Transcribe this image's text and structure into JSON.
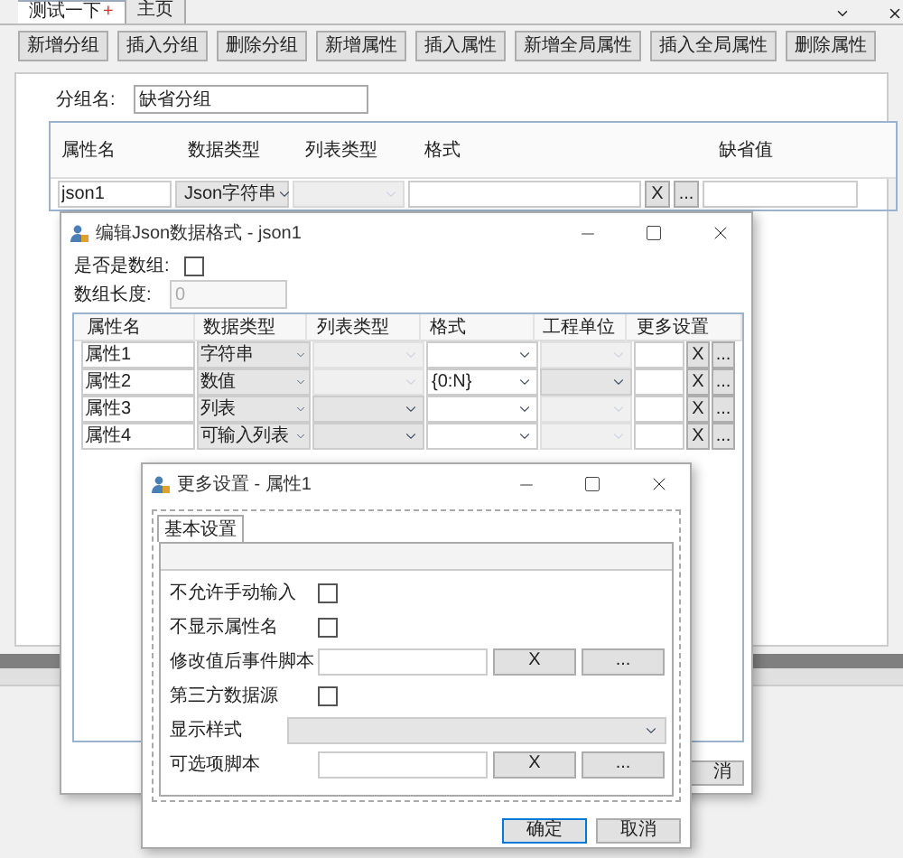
{
  "tabs": [
    {
      "label": "测试一下",
      "selected": true,
      "mark": "+"
    },
    {
      "label": "主页",
      "selected": false
    }
  ],
  "toolbar": [
    "新增分组",
    "插入分组",
    "删除分组",
    "新增属性",
    "插入属性",
    "新增全局属性",
    "插入全局属性",
    "删除属性"
  ],
  "group_name": {
    "label": "分组名:",
    "value": "缺省分组"
  },
  "property_table": {
    "columns": [
      "属性名",
      "数据类型",
      "列表类型",
      "格式",
      "缺省值"
    ],
    "rows": [
      {
        "name": "json1",
        "data_type": "Json字符串",
        "clear_button": "X",
        "more_button": "..."
      }
    ]
  },
  "json_dialog": {
    "title": "编辑Json数据格式 - json1",
    "is_array": {
      "label": "是否是数组:",
      "checked": false
    },
    "array_length": {
      "label": "数组长度:",
      "value": "0",
      "disabled": true
    },
    "columns": [
      "属性名",
      "数据类型",
      "列表类型",
      "格式",
      "工程单位",
      "更多设置"
    ],
    "rows": [
      {
        "name": "属性1",
        "data_type": "字符串",
        "list_type_enabled": false,
        "unit_enabled": false,
        "clear_button": "X",
        "more_button": "..."
      },
      {
        "name": "属性2",
        "data_type": "数值",
        "list_type_enabled": false,
        "format": "{0:N}",
        "unit_enabled": true,
        "clear_button": "X",
        "more_button": "..."
      },
      {
        "name": "属性3",
        "data_type": "列表",
        "list_type_enabled": true,
        "unit_enabled": false,
        "clear_button": "X",
        "more_button": "..."
      },
      {
        "name": "属性4",
        "data_type": "可输入列表",
        "list_type_enabled": true,
        "unit_enabled": false,
        "clear_button": "X",
        "more_button": "..."
      }
    ],
    "cancel_button": "消"
  },
  "settings_dialog": {
    "title": "更多设置 - 属性1",
    "tabs": [
      {
        "label": "基本设置",
        "selected": true
      }
    ],
    "rows": [
      {
        "kind": "checkbox",
        "label": "不允许手动输入",
        "checked": false
      },
      {
        "kind": "checkbox",
        "label": "不显示属性名",
        "checked": false
      },
      {
        "kind": "script",
        "label": "修改值后事件脚本",
        "clear_button": "X",
        "more_button": "..."
      },
      {
        "kind": "checkbox",
        "label": "第三方数据源",
        "checked": false
      },
      {
        "kind": "select",
        "label": "显示样式"
      },
      {
        "kind": "script",
        "label": "可选项脚本",
        "clear_button": "X",
        "more_button": "..."
      }
    ],
    "buttons": [
      "确定",
      "取消"
    ]
  }
}
